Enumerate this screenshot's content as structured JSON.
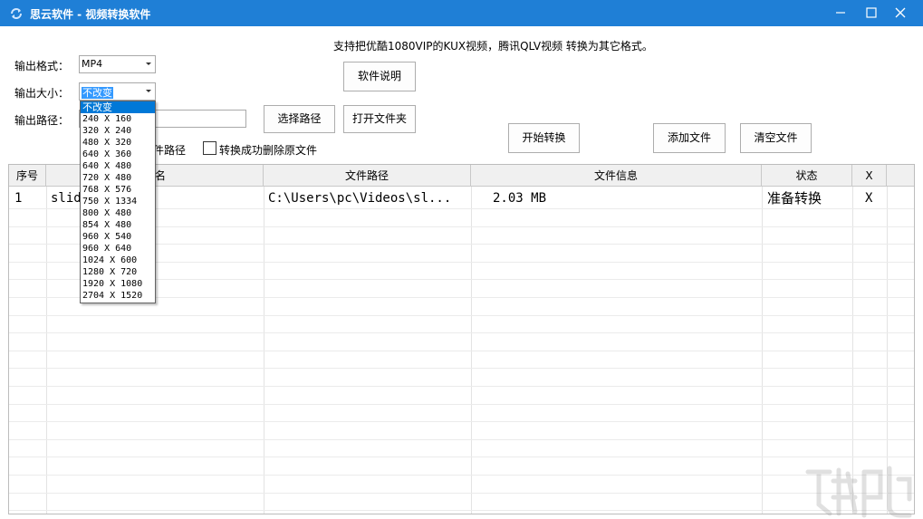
{
  "window": {
    "title": "思云软件 - 视频转换软件",
    "accent": "#1f7fd6"
  },
  "notice": "支持把优酷1080VIP的KUX视频，腾讯QLV视频 转换为其它格式。",
  "form": {
    "format_label": "输出格式：",
    "format_value": "MP4",
    "size_label": "输出大小：",
    "size_value": "不改变",
    "path_label": "输出路径：",
    "path_value": "",
    "same_path_label_partial": "件路径",
    "delete_label": "转换成功删除原文件"
  },
  "buttons": {
    "help": "软件说明",
    "choose_path": "选择路径",
    "open_folder": "打开文件夹",
    "start": "开始转换",
    "add_file": "添加文件",
    "clear_file": "清空文件"
  },
  "table": {
    "columns": [
      "序号",
      "名",
      "文件路径",
      "文件信息",
      "状态",
      "X"
    ],
    "rows": [
      {
        "index": "1",
        "name": "slid",
        "path": "C:\\Users\\pc\\Videos\\sl...",
        "info": "2.03 MB",
        "status": "准备转换",
        "remove": "X"
      }
    ]
  },
  "size_dropdown": {
    "options": [
      "不改变",
      "240 X 160",
      "320 X 240",
      "480 X 320",
      "640 X 360",
      "640 X 480",
      "720 X 480",
      "768 X 576",
      "750 X 1334",
      "800 X 480",
      "854 X 480",
      "960 X 540",
      "960 X 640",
      "1024 X 600",
      "1280 X 720",
      "1920 X 1080",
      "2704 X 1520"
    ],
    "selected_index": 0
  },
  "icons": {
    "app": "refresh-icon",
    "minimize": "minimize-icon",
    "maximize": "maximize-icon",
    "close": "close-icon"
  }
}
